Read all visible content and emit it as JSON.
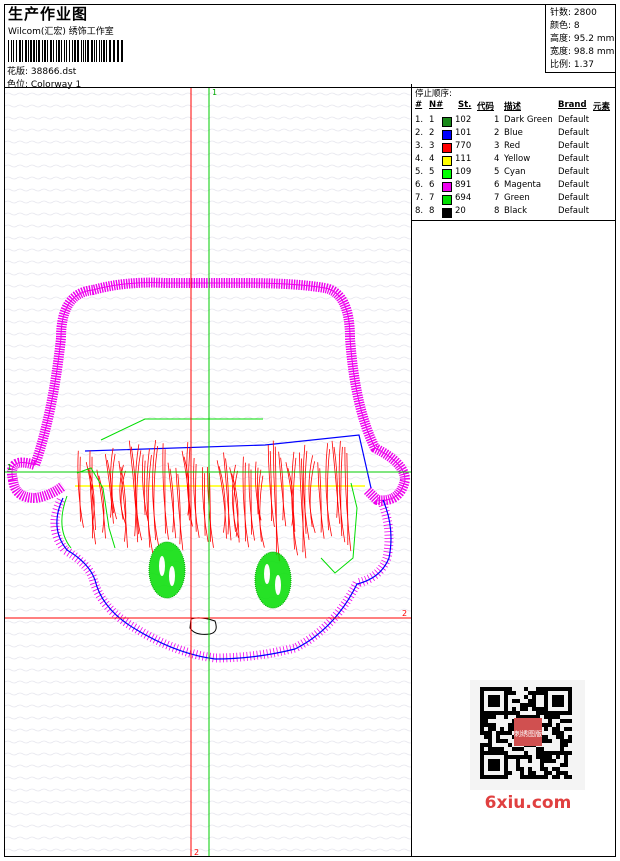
{
  "header": {
    "title": "生产作业图",
    "company": "Wilcom(汇宏) 绣饰工作室",
    "design_label": "花版: 38866.dst",
    "colorway_label": "色位: Colorway 1"
  },
  "stats": [
    {
      "label": "针数",
      "value": "2800"
    },
    {
      "label": "颜色",
      "value": "8"
    },
    {
      "label": "高度",
      "value": "95.2 mm"
    },
    {
      "label": "宽度",
      "value": "98.8 mm"
    },
    {
      "label": "比例",
      "value": "1.37"
    }
  ],
  "stop_sequence": {
    "title": "停止顺序:",
    "columns": [
      "#",
      "N#",
      "St.",
      "代码",
      "描述",
      "Brand",
      "元素"
    ],
    "rows": [
      {
        "num": "1.",
        "n": "1",
        "st": "102",
        "code": "1",
        "desc": "Dark Green",
        "brand": "Default",
        "color": "#1a8a1a"
      },
      {
        "num": "2.",
        "n": "2",
        "st": "101",
        "code": "2",
        "desc": "Blue",
        "brand": "Default",
        "color": "#0000ff"
      },
      {
        "num": "3.",
        "n": "3",
        "st": "770",
        "code": "3",
        "desc": "Red",
        "brand": "Default",
        "color": "#ff0000"
      },
      {
        "num": "4.",
        "n": "4",
        "st": "111",
        "code": "4",
        "desc": "Yellow",
        "brand": "Default",
        "color": "#ffff00"
      },
      {
        "num": "5.",
        "n": "5",
        "st": "109",
        "code": "5",
        "desc": "Cyan",
        "brand": "Default",
        "color": "#00ff00"
      },
      {
        "num": "6.",
        "n": "6",
        "st": "891",
        "code": "6",
        "desc": "Magenta",
        "brand": "Default",
        "color": "#ee00ee"
      },
      {
        "num": "7.",
        "n": "7",
        "st": "694",
        "code": "7",
        "desc": "Green",
        "brand": "Default",
        "color": "#00dd00"
      },
      {
        "num": "8.",
        "n": "8",
        "st": "20",
        "code": "8",
        "desc": "Black",
        "brand": "Default",
        "color": "#000000"
      }
    ]
  },
  "axes": {
    "top": "1",
    "bottom": "2",
    "right": "2",
    "left": "1"
  },
  "watermark": {
    "text": "6xiu.com",
    "badge": "刺绣图版"
  },
  "colors": {
    "magenta": "#ee00ee",
    "red": "#ff0000",
    "green": "#00dd00",
    "blue": "#0000ff",
    "yellow": "#ffff00"
  }
}
